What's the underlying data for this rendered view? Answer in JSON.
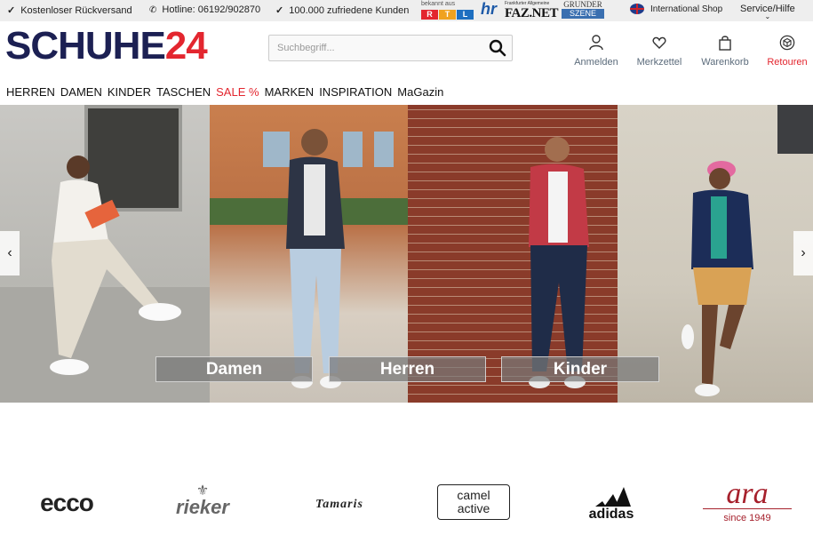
{
  "topbar": {
    "usps": [
      "Kostenloser Rückversand",
      "Hotline: 06192/902870",
      "100.000 zufriedene Kunden"
    ],
    "press": {
      "bekannt_aus": "bekannt aus",
      "rtl": "RTL",
      "hr": "hr",
      "faz_small": "Frankfurter Allgemeine",
      "faz": "FAZ.NET",
      "gruender_a": "GRUNDER",
      "gruender_b": "SZENE"
    },
    "international": "International Shop",
    "service": "Service/Hilfe"
  },
  "header": {
    "logo_main": "SCHUHE",
    "logo_num": "24",
    "search_placeholder": "Suchbegriff...",
    "icons": [
      {
        "label": "Anmelden",
        "icon": "user-icon"
      },
      {
        "label": "Merkzettel",
        "icon": "heart-icon"
      },
      {
        "label": "Warenkorb",
        "icon": "bag-icon"
      },
      {
        "label": "Retouren",
        "icon": "return-box-icon"
      }
    ]
  },
  "nav": [
    "HERREN",
    "DAMEN",
    "KINDER",
    "TASCHEN",
    "SALE %",
    "MARKEN",
    "INSPIRATION",
    "MaGazin"
  ],
  "hero": {
    "buttons": [
      "Damen",
      "Herren",
      "Kinder"
    ],
    "prev_icon": "chevron-left-icon",
    "next_icon": "chevron-right-icon"
  },
  "brands": [
    {
      "name": "ecco"
    },
    {
      "name": "rieker"
    },
    {
      "name": "Tamaris"
    },
    {
      "name": "camel active"
    },
    {
      "name": "adidas"
    },
    {
      "name": "ara",
      "sub": "since 1949"
    }
  ],
  "colors": {
    "brand_dark": "#1c2053",
    "brand_red": "#e3262f"
  }
}
